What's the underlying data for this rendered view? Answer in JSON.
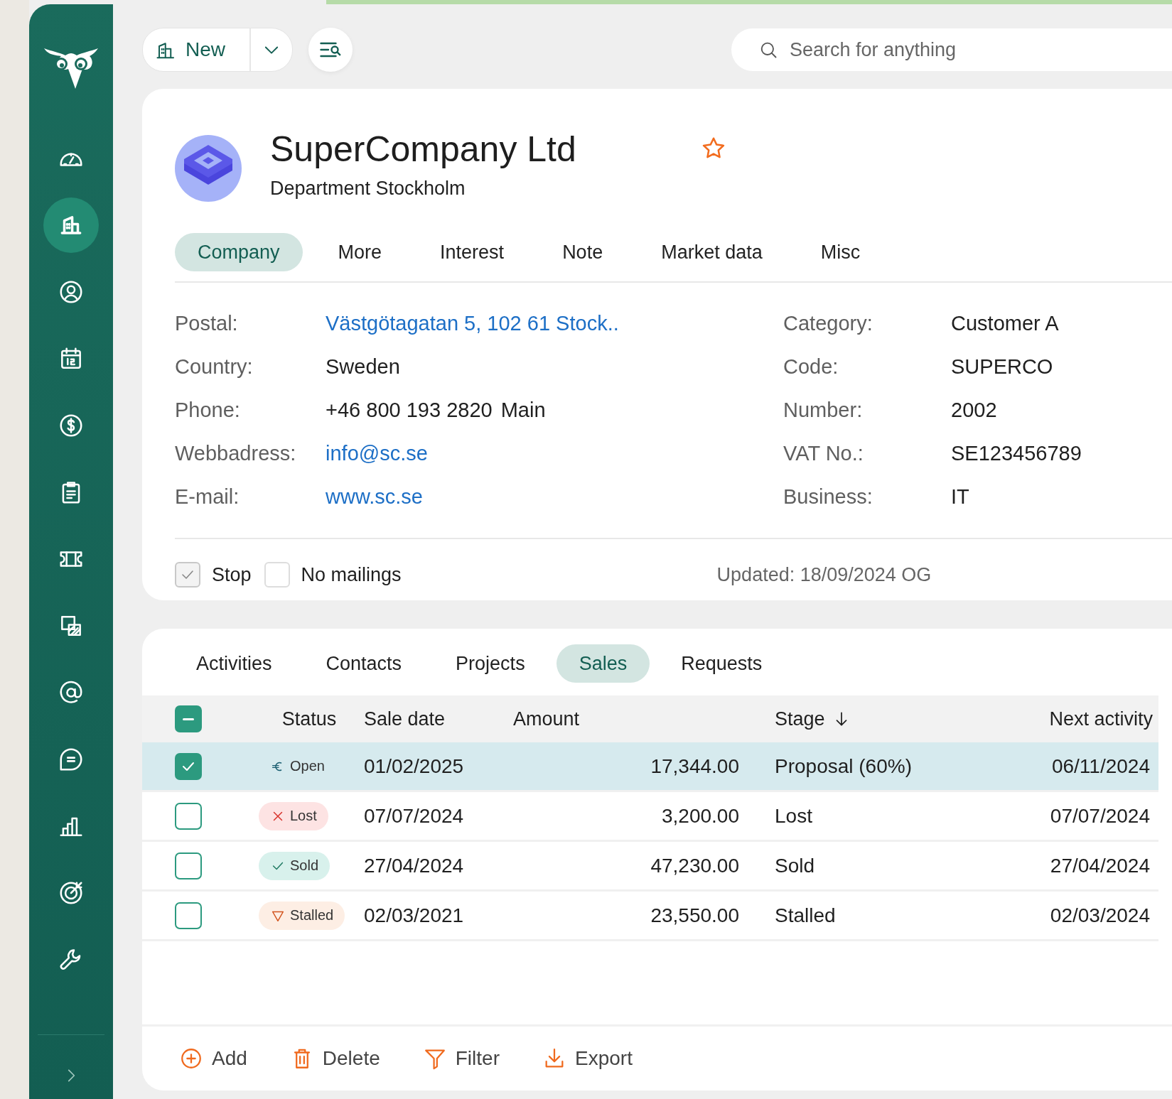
{
  "sidebar": {
    "items": [
      {
        "kind": "dashboard",
        "selected": false
      },
      {
        "kind": "company",
        "selected": true
      },
      {
        "kind": "contact",
        "selected": false
      },
      {
        "kind": "calendar",
        "selected": false
      },
      {
        "kind": "sales",
        "selected": false
      },
      {
        "kind": "clipboard",
        "selected": false
      },
      {
        "kind": "ticket",
        "selected": false
      },
      {
        "kind": "documents",
        "selected": false
      },
      {
        "kind": "mail",
        "selected": false
      },
      {
        "kind": "chat",
        "selected": false
      },
      {
        "kind": "chart",
        "selected": false
      },
      {
        "kind": "target",
        "selected": false
      },
      {
        "kind": "tools",
        "selected": false
      }
    ]
  },
  "toolbar": {
    "new_button": "New",
    "search": {
      "placeholder": "Search for anything"
    }
  },
  "company": {
    "name": "SuperCompany Ltd",
    "department": "Department Stockholm",
    "favorite": false
  },
  "tabs": [
    {
      "label": "Company",
      "selected": true
    },
    {
      "label": "More",
      "selected": false
    },
    {
      "label": "Interest",
      "selected": false
    },
    {
      "label": "Note",
      "selected": false
    },
    {
      "label": "Market data",
      "selected": false
    },
    {
      "label": "Misc",
      "selected": false
    }
  ],
  "fields_left": [
    {
      "label": "Postal:",
      "value": "Västgötagatan 5, 102 61 Stock..",
      "link": true
    },
    {
      "label": "Country:",
      "value": "Sweden",
      "link": false
    },
    {
      "label": "Phone:",
      "value": "+46 800 193 2820",
      "suffix": "Main",
      "link": false
    },
    {
      "label": "Webbadress:",
      "value": "info@sc.se",
      "link": true
    },
    {
      "label": "E-mail:",
      "value": "www.sc.se",
      "link": true
    }
  ],
  "fields_right": [
    {
      "label": "Category:",
      "value": "Customer A"
    },
    {
      "label": "Code:",
      "value": "SUPERCO"
    },
    {
      "label": "Number:",
      "value": "2002"
    },
    {
      "label": "VAT No.:",
      "value": "SE123456789"
    },
    {
      "label": "Business:",
      "value": "IT"
    }
  ],
  "flags": [
    {
      "label": "Stop",
      "checked": true
    },
    {
      "label": "No mailings",
      "checked": false
    }
  ],
  "updated": "Updated: 18/09/2024 OG",
  "related_tabs": [
    {
      "label": "Activities",
      "selected": false
    },
    {
      "label": "Contacts",
      "selected": false
    },
    {
      "label": "Projects",
      "selected": false
    },
    {
      "label": "Sales",
      "selected": true
    },
    {
      "label": "Requests",
      "selected": false
    }
  ],
  "table": {
    "select_all_partial": true,
    "columns": [
      {
        "label": "Status"
      },
      {
        "label": "Sale date"
      },
      {
        "label": "Amount"
      },
      {
        "label": "Stage",
        "sorted": true
      },
      {
        "label": "Next activity"
      }
    ],
    "rows": [
      {
        "selected": true,
        "status": {
          "kind": "open",
          "label": "Open"
        },
        "sale_date": "01/02/2025",
        "amount": "17,344.00",
        "stage": "Proposal (60%)",
        "next_activity": "06/11/2024"
      },
      {
        "selected": false,
        "status": {
          "kind": "lost",
          "label": "Lost"
        },
        "sale_date": "07/07/2024",
        "amount": "3,200.00",
        "stage": "Lost",
        "next_activity": "07/07/2024"
      },
      {
        "selected": false,
        "status": {
          "kind": "sold",
          "label": "Sold"
        },
        "sale_date": "27/04/2024",
        "amount": "47,230.00",
        "stage": "Sold",
        "next_activity": "27/04/2024"
      },
      {
        "selected": false,
        "status": {
          "kind": "stalled",
          "label": "Stalled"
        },
        "sale_date": "02/03/2021",
        "amount": "23,550.00",
        "stage": "Stalled",
        "next_activity": "02/03/2024"
      }
    ]
  },
  "actions": [
    {
      "kind": "add",
      "label": "Add"
    },
    {
      "kind": "delete",
      "label": "Delete"
    },
    {
      "kind": "filter",
      "label": "Filter"
    },
    {
      "kind": "export",
      "label": "Export"
    }
  ]
}
